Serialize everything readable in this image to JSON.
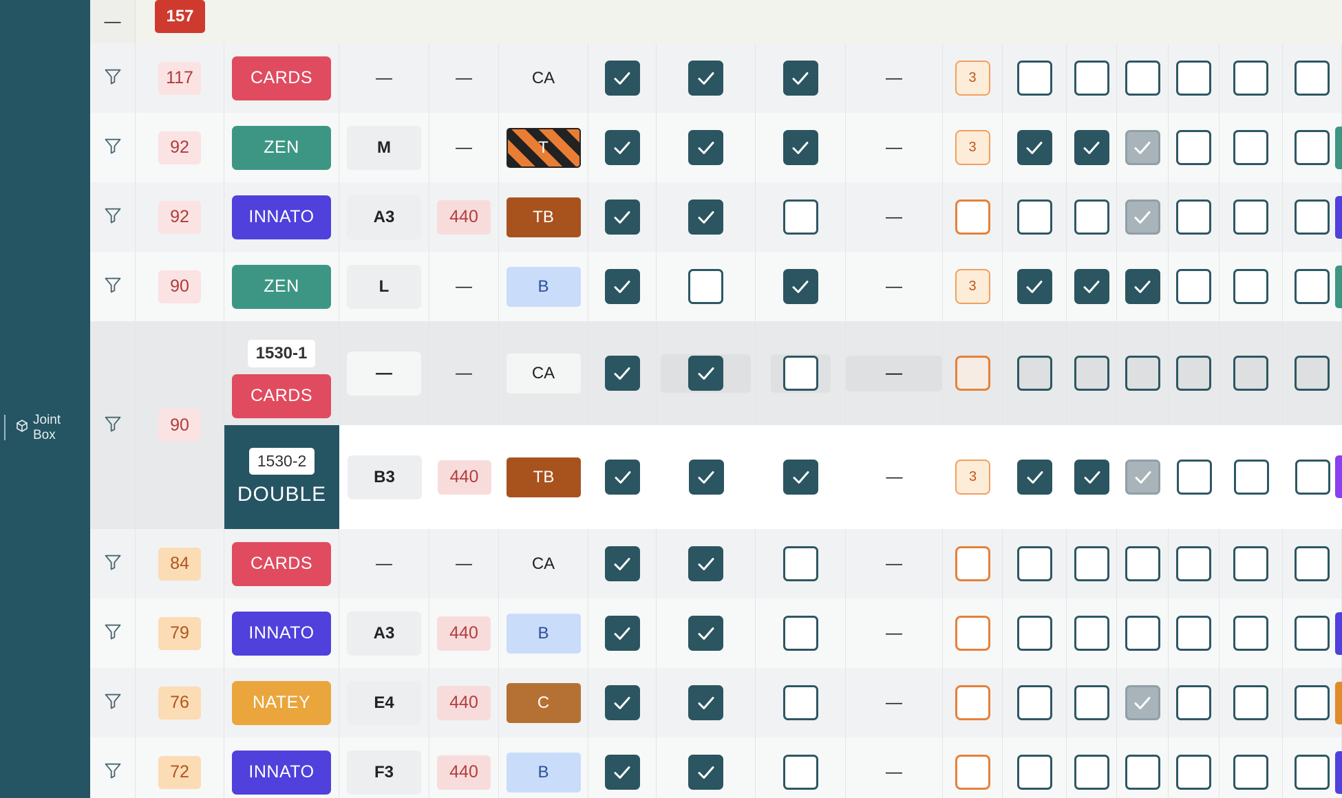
{
  "sidebar": {
    "item_label": "Joint Box",
    "item_icon": "cube-icon"
  },
  "top": {
    "dash": "—",
    "badge": "157"
  },
  "rows": [
    {
      "num": "117",
      "num_style": "pink",
      "brand": "CARDS",
      "brand_color": "#e04b5f",
      "size": "—",
      "v440": "—",
      "type": "CA",
      "type_style": "plain",
      "c1": true,
      "c2": true,
      "c3": true,
      "dash": "—",
      "orange": "3",
      "g": [
        false,
        false,
        false,
        false,
        false,
        false
      ],
      "edge": ""
    },
    {
      "num": "92",
      "num_style": "pink",
      "brand": "ZEN",
      "brand_color": "#3d9683",
      "size": "M",
      "v440": "—",
      "type": "T",
      "type_style": "stripe",
      "c1": true,
      "c2": true,
      "c3": true,
      "dash": "—",
      "orange": "3",
      "g": [
        true,
        true,
        "gray",
        false,
        false,
        false
      ],
      "edge": "#3d9683"
    },
    {
      "num": "92",
      "num_style": "pink",
      "brand": "INNATO",
      "brand_color": "#5040dc",
      "size": "A3",
      "v440": "440",
      "type": "TB",
      "type_style": "brown",
      "c1": true,
      "c2": true,
      "c3": false,
      "dash": "—",
      "orange": "",
      "g": [
        false,
        false,
        "gray",
        false,
        false,
        false
      ],
      "edge": "#5040dc"
    },
    {
      "num": "90",
      "num_style": "pink",
      "brand": "ZEN",
      "brand_color": "#3d9683",
      "size": "L",
      "v440": "—",
      "type": "B",
      "type_style": "blue",
      "c1": true,
      "c2": false,
      "c3": true,
      "dash": "—",
      "orange": "3",
      "g": [
        true,
        true,
        true,
        false,
        false,
        false
      ],
      "edge": "#3d9683"
    }
  ],
  "group": {
    "num": "90",
    "sub1": {
      "tag": "1530-1",
      "brand": "CARDS",
      "brand_color": "#e04b5f",
      "size": "—",
      "v440": "—",
      "type": "CA",
      "c1": true,
      "c2": true,
      "c3": false,
      "dash": "—",
      "orange": ""
    },
    "sub2": {
      "tag": "1530-2",
      "brand": "DOUBLE",
      "size": "B3",
      "v440": "440",
      "type": "TB",
      "c1": true,
      "c2": true,
      "c3": true,
      "dash": "—",
      "orange": "3",
      "g": [
        true,
        true,
        "gray",
        false,
        false,
        false
      ],
      "edge": "#8a3ff0"
    }
  },
  "rows2": [
    {
      "num": "84",
      "num_style": "peach",
      "brand": "CARDS",
      "brand_color": "#e04b5f",
      "size": "—",
      "v440": "—",
      "type": "CA",
      "type_style": "plain",
      "c1": true,
      "c2": true,
      "c3": false,
      "dash": "—",
      "orange": "",
      "g": [
        false,
        false,
        false,
        false,
        false,
        false
      ],
      "edge": ""
    },
    {
      "num": "79",
      "num_style": "peach",
      "brand": "INNATO",
      "brand_color": "#5040dc",
      "size": "A3",
      "v440": "440",
      "type": "B",
      "type_style": "blue",
      "c1": true,
      "c2": true,
      "c3": false,
      "dash": "—",
      "orange": "",
      "g": [
        false,
        false,
        false,
        false,
        false,
        false
      ],
      "edge": "#5040dc"
    },
    {
      "num": "76",
      "num_style": "peach",
      "brand": "NATEY",
      "brand_color": "#eaa53c",
      "size": "E4",
      "v440": "440",
      "type": "C",
      "type_style": "tan",
      "c1": true,
      "c2": true,
      "c3": false,
      "dash": "—",
      "orange": "",
      "g": [
        false,
        false,
        "gray",
        false,
        false,
        false
      ],
      "edge": "#e08a2a"
    },
    {
      "num": "72",
      "num_style": "peach",
      "brand": "INNATO",
      "brand_color": "#5040dc",
      "size": "F3",
      "v440": "440",
      "type": "B",
      "type_style": "blue",
      "c1": true,
      "c2": true,
      "c3": false,
      "dash": "—",
      "orange": "",
      "g": [
        false,
        false,
        false,
        false,
        false,
        false
      ],
      "edge": "#5040dc"
    }
  ],
  "colors": {
    "sidebar": "#255463",
    "check_on": "#2b5560",
    "badge_red": "#cf3a2e"
  }
}
